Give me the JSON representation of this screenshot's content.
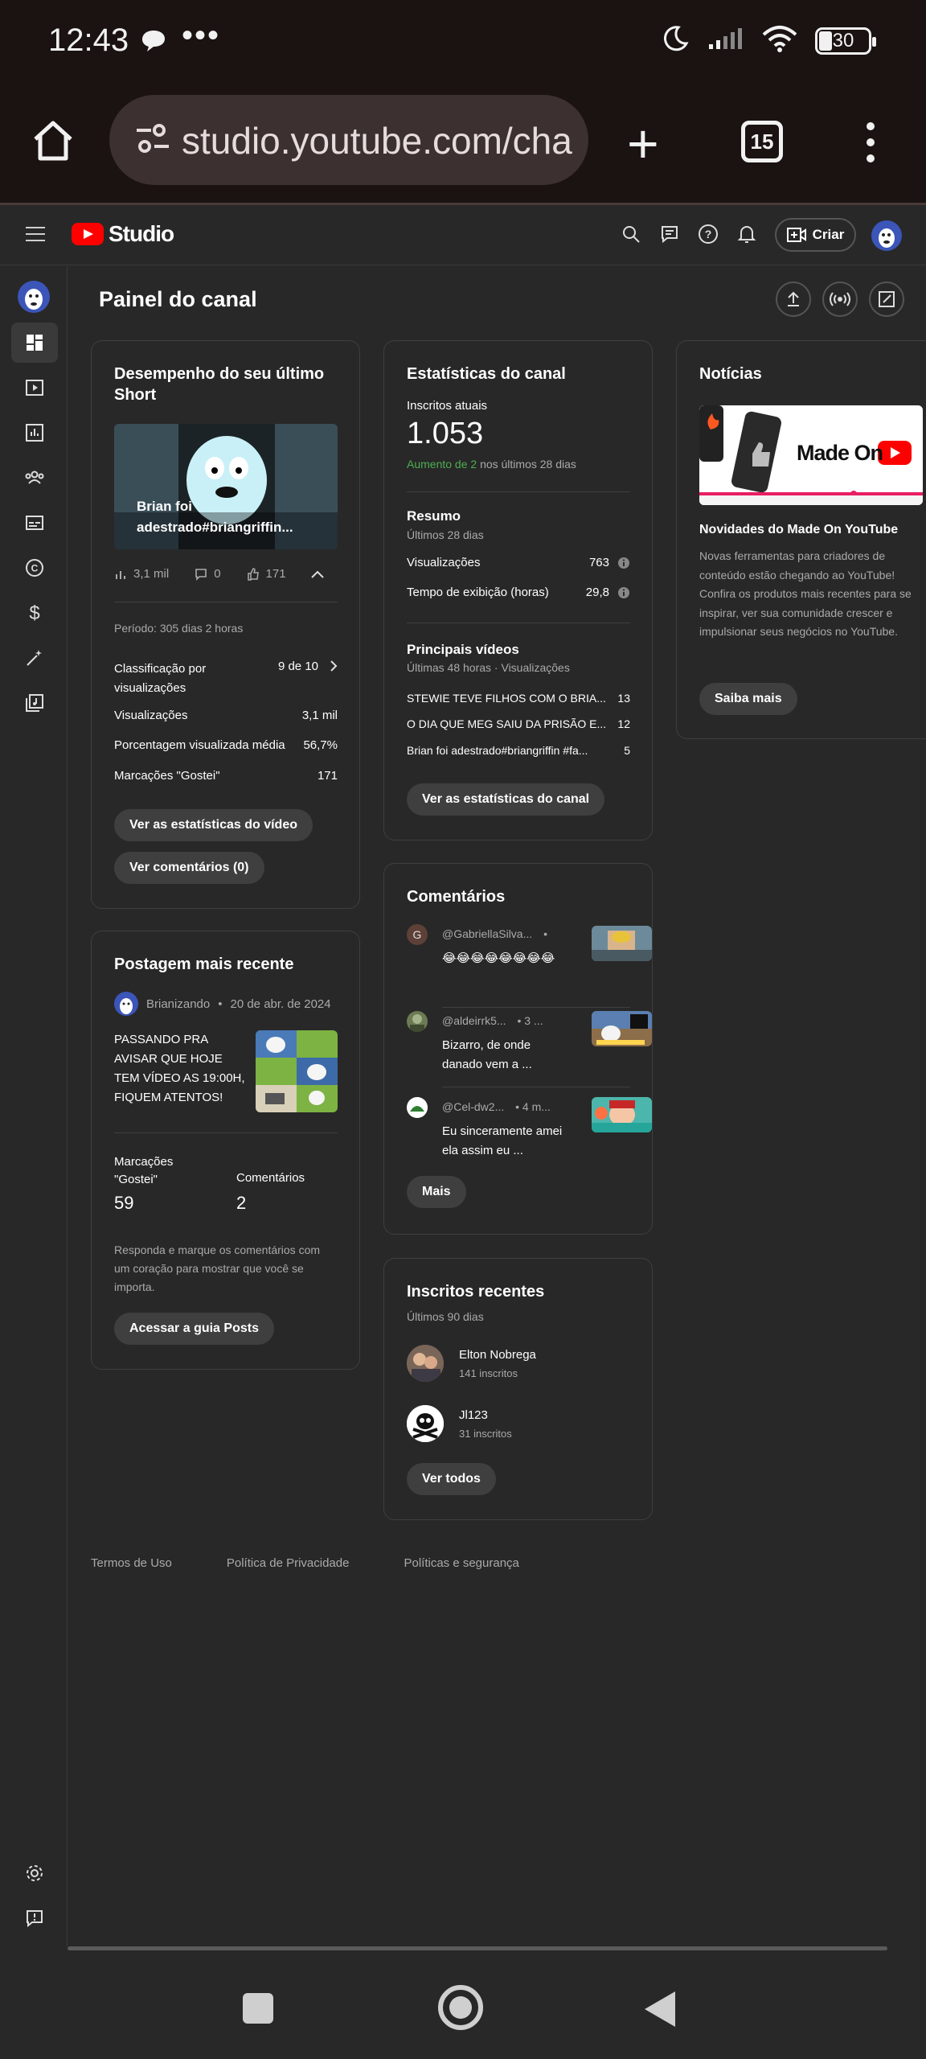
{
  "status_bar": {
    "time": "12:43",
    "battery": "30"
  },
  "browser": {
    "url": "studio.youtube.com/cha",
    "tab_count": "15"
  },
  "header": {
    "logo_text": "Studio",
    "create_label": "Criar"
  },
  "page_title": "Painel do canal",
  "short_card": {
    "title": "Desempenho do seu último Short",
    "thumb_caption": "Brian foi adestrado#briangriffin...",
    "views": "3,1 mil",
    "comments": "0",
    "likes": "171",
    "period": "Período: 305 dias 2 horas",
    "ranking_label": "Classificação por visualizações",
    "ranking_value": "9 de 10",
    "stats": [
      {
        "label": "Visualizações",
        "value": "3,1 mil"
      },
      {
        "label": "Porcentagem visualizada média",
        "value": "56,7%"
      },
      {
        "label": "Marcações \"Gostei\"",
        "value": "171"
      }
    ],
    "btn_stats": "Ver as estatísticas do vídeo",
    "btn_comments": "Ver comentários (0)"
  },
  "post_card": {
    "title": "Postagem mais recente",
    "author": "Brianizando",
    "date": "20 de abr. de 2024",
    "text": "PASSANDO PRA AVISAR QUE HOJE TEM VÍDEO AS 19:00H, FIQUEM ATENTOS!",
    "likes_label": "Marcações \"Gostei\"",
    "likes_value": "59",
    "comments_label": "Comentários",
    "comments_value": "2",
    "hint": "Responda e marque os comentários com um coração para mostrar que você se importa.",
    "btn": "Acessar a guia Posts"
  },
  "stats_card": {
    "title": "Estatísticas do canal",
    "subs_label": "Inscritos atuais",
    "subs_value": "1.053",
    "subs_delta": "Aumento de 2",
    "subs_delta_suffix": "nos últimos 28 dias",
    "summary_title": "Resumo",
    "summary_sub": "Últimos 28 dias",
    "summary_rows": [
      {
        "label": "Visualizações",
        "value": "763"
      },
      {
        "label": "Tempo de exibição (horas)",
        "value": "29,8"
      }
    ],
    "top_title": "Principais vídeos",
    "top_sub": "Últimas 48 horas · Visualizações",
    "top_rows": [
      {
        "label": "STEWIE TEVE FILHOS COM O BRIA...",
        "value": "13"
      },
      {
        "label": "O DIA QUE MEG SAIU DA PRISÃO E...",
        "value": "12"
      },
      {
        "label": "Brian foi adestrado#briangriffin #fa...",
        "value": "5"
      }
    ],
    "btn": "Ver as estatísticas do canal"
  },
  "comments_card": {
    "title": "Comentários",
    "items": [
      {
        "author": "@GabriellaSilva...",
        "time": "•",
        "text": "😂😂😂😂😂😂😂😂",
        "initial": "G"
      },
      {
        "author": "@aldeirrk5...",
        "time": "• 3 ...",
        "text": "Bizarro, de onde danado vem a ...",
        "initial": ""
      },
      {
        "author": "@Cel-dw2...",
        "time": "• 4 m...",
        "text": "Eu sinceramente amei ela assim eu ...",
        "initial": ""
      }
    ],
    "btn": "Mais"
  },
  "subs_card": {
    "title": "Inscritos recentes",
    "sub": "Últimos 90 dias",
    "items": [
      {
        "name": "Elton Nobrega",
        "count": "141 inscritos"
      },
      {
        "name": "Jl123",
        "count": "31 inscritos"
      }
    ],
    "btn": "Ver todos"
  },
  "news_card": {
    "title": "Notícias",
    "banner_text": "Made On",
    "headline": "Novidades do Made On YouTube",
    "body": "Novas ferramentas para criadores de conteúdo estão chegando ao YouTube! Confira os produtos mais recentes para se inspirar, ver sua comunidade crescer e impulsionar seus negócios no YouTube.",
    "btn": "Saiba mais"
  },
  "footer": {
    "links": [
      "Termos de Uso",
      "Política de Privacidade",
      "Políticas e segurança"
    ]
  },
  "colors": {
    "accent_green": "#4caf50",
    "youtube_red": "#ff0000",
    "card_border": "#3f3f3f",
    "background": "#282828"
  }
}
